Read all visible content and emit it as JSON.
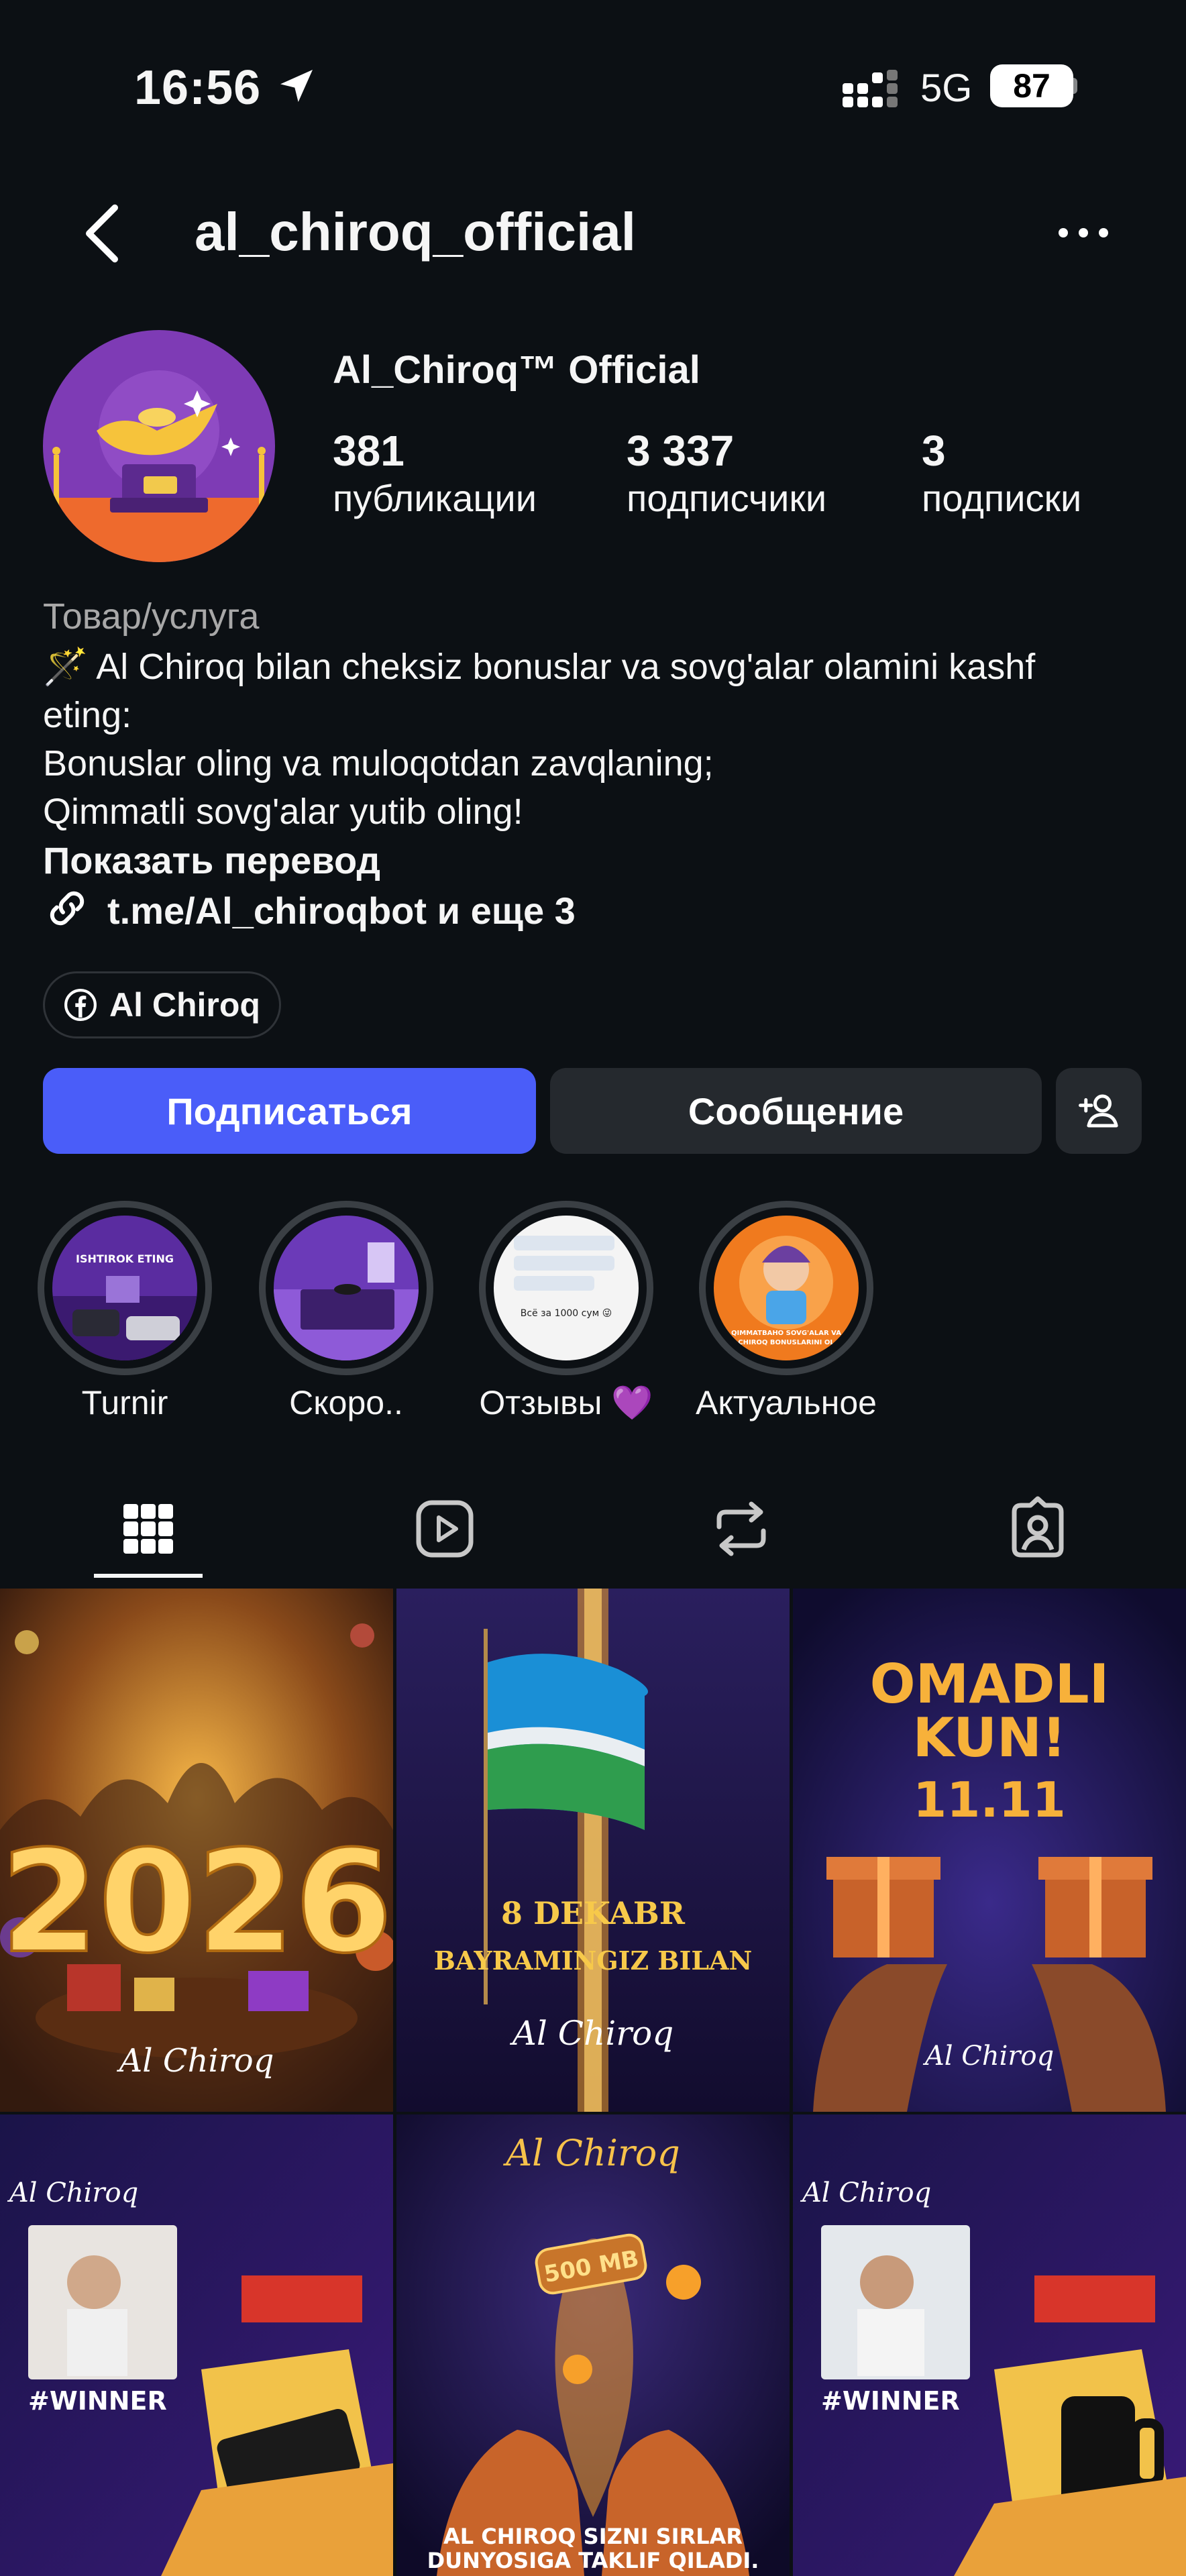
{
  "status_bar": {
    "time": "16:56",
    "network": "5G",
    "battery": "87"
  },
  "header": {
    "username": "al_chiroq_official"
  },
  "profile": {
    "display_name": "Al_Chiroq™ Official",
    "stats": [
      {
        "value": "381",
        "label": "публикации"
      },
      {
        "value": "3 337",
        "label": "подписчики"
      },
      {
        "value": "3",
        "label": "подписки"
      }
    ],
    "category": "Товар/услуга",
    "bio_lines": [
      "🪄 Al Chiroq bilan cheksiz bonuslar va sovg'alar olamini kashf",
      "eting:",
      "Bonuslar oling va muloqotdan zavqlaning;",
      "Qimmatli sovg'alar yutib oling!"
    ],
    "show_translation": "Показать перевод",
    "link": "t.me/Al_chiroqbot и еще 3",
    "facebook_chip": "Al Chiroq"
  },
  "actions": {
    "follow": "Подписаться",
    "message": "Сообщение"
  },
  "highlights": [
    {
      "label": "Turnir"
    },
    {
      "label": "Скоро.."
    },
    {
      "label": "Отзывы 💜"
    },
    {
      "label": "Актуальное"
    }
  ],
  "highlight_texts": {
    "h1": "ISHTIROK ETING",
    "h3_line": "Всё за 1000 сум 😜",
    "h4_line1": "QIMMATBAHO SOVG'ALAR VA",
    "h4_line2": "CHIROQ BONUSLARINI OL"
  },
  "posts": {
    "p1_text": "2026",
    "p1_brand": "Al Chiroq",
    "p2_line1": "8 DEKABR",
    "p2_line2": "BAYRAMINGIZ BILAN",
    "p2_brand": "Al Chiroq",
    "p3_line1": "OMADLI",
    "p3_line2": "KUN!",
    "p3_line3": "11.11",
    "p3_brand": "Al Chiroq",
    "p4_brand": "Al Chiroq",
    "p4_tag": "#WINNER",
    "p5_brand": "Al Chiroq",
    "p5_badge": "500 MB",
    "p5_line1": "AL CHIROQ SIZNI SIRLAR",
    "p5_line2": "DUNYOSIGA TAKLIF QILADI.",
    "p6_brand": "Al Chiroq",
    "p6_tag": "#WINNER"
  }
}
